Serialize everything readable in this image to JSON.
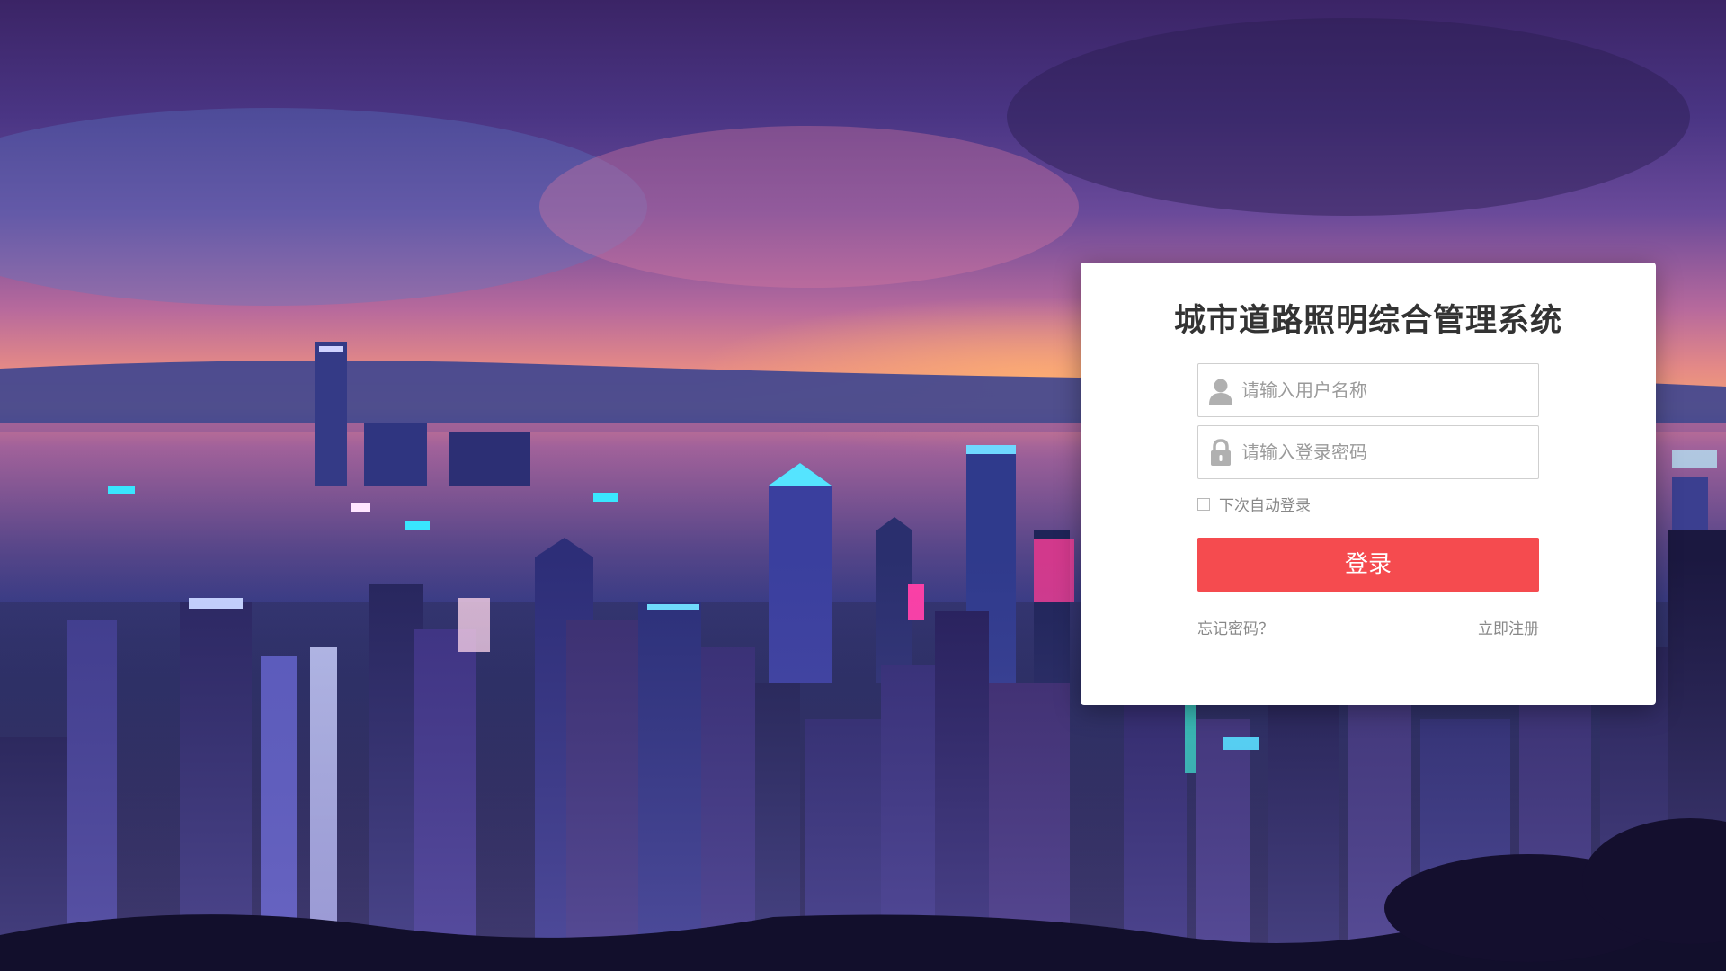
{
  "app": {
    "title": "城市道路照明综合管理系统"
  },
  "login_form": {
    "username": {
      "placeholder": "请输入用户名称",
      "value": "",
      "icon": "user-icon"
    },
    "password": {
      "placeholder": "请输入登录密码",
      "value": "",
      "icon": "lock-icon"
    },
    "remember": {
      "label": "下次自动登录",
      "checked": false
    },
    "submit_label": "登录",
    "forgot_label": "忘记密码？",
    "register_label": "立即注册"
  },
  "colors": {
    "primary_button": "#f54b4f",
    "title_text": "#333333",
    "secondary_text": "#888888"
  }
}
